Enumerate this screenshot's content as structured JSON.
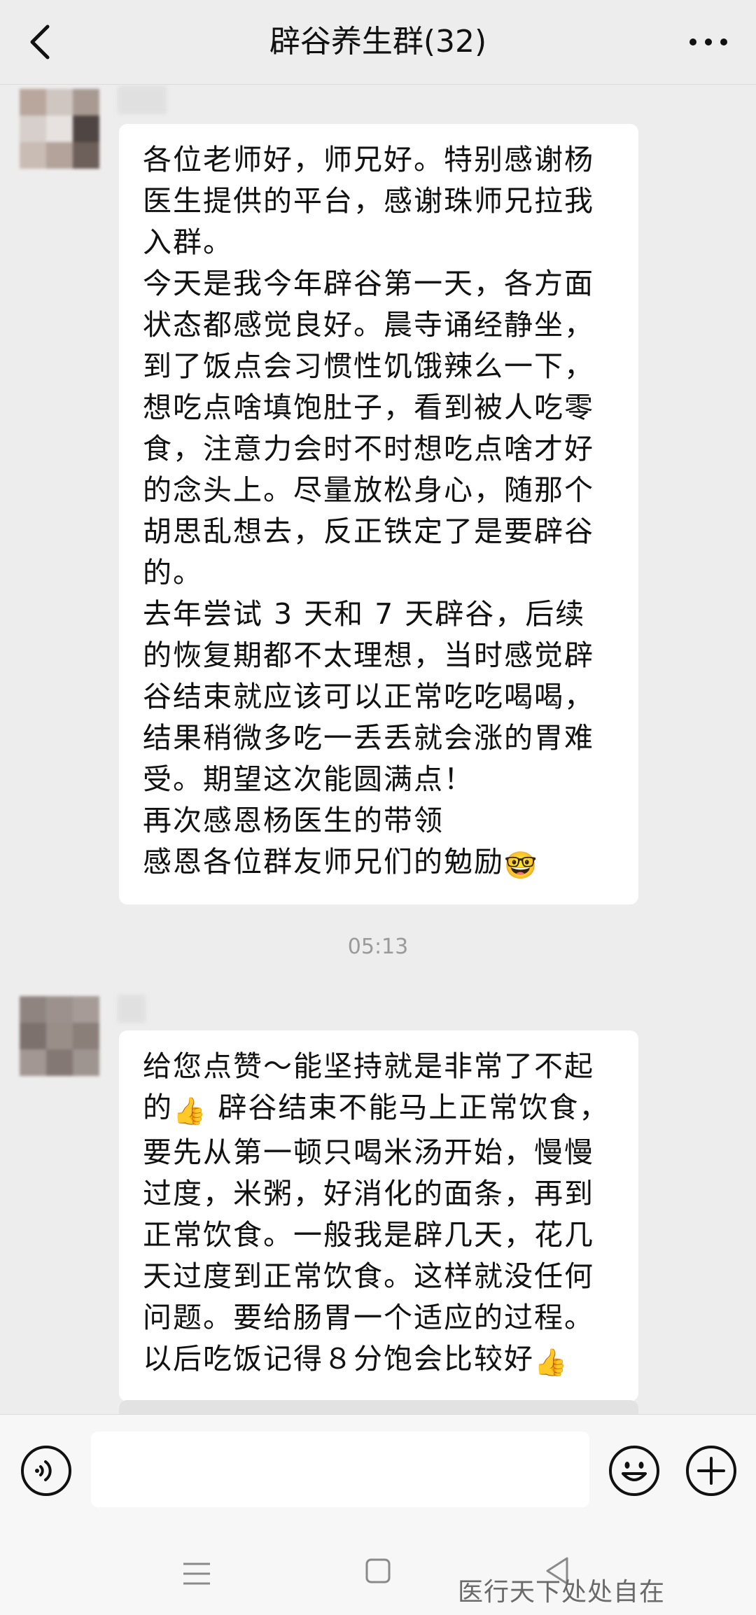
{
  "header": {
    "title": "辟谷养生群(32)"
  },
  "messages": [
    {
      "paragraphs": [
        "各位老师好，师兄好。特别感谢杨医生提供的平台，感谢珠师兄拉我入群。",
        "今天是我今年辟谷第一天，各方面状态都感觉良好。晨寺诵经静坐，到了饭点会习惯性饥饿辣么一下，想吃点啥填饱肚子，看到被人吃零食，注意力会时不时想吃点啥才好的念头上。尽量放松身心，随那个胡思乱想去，反正铁定了是要辟谷的。",
        "去年尝试 3 天和 7 天辟谷，后续的恢复期都不太理想，当时感觉辟谷结束就应该可以正常吃吃喝喝，结果稍微多吃一丢丢就会涨的胃难受。期望这次能圆满点！",
        "再次感恩杨医生的带领",
        "感恩各位群友师兄们的勉励"
      ],
      "end_emoji": "🤓"
    },
    {
      "timestamp": "05:13"
    },
    {
      "part1": "给您点赞～能坚持就是非常了不起的",
      "emoji1": "👍",
      "part2": " 辟谷结束不能马上正常饮食，要先从第一顿只喝米汤开始，慢慢过度，米粥，好消化的面条，再到正常饮食。一般我是辟几天，花几天过度到正常饮食。这样就没任何问题。要给肠胃一个适应的过程。以后吃饭记得８分饱会比较好",
      "emoji2": "👍"
    }
  ],
  "watermark": "医行天下处处自在",
  "icons": {
    "back": "chevron-left-icon",
    "more": "more-dots-icon",
    "voice": "voice-icon",
    "emoji": "emoji-face-icon",
    "plus": "plus-icon",
    "nav_menu": "menu-icon",
    "nav_home": "home-square-icon",
    "nav_back": "nav-back-triangle-icon"
  }
}
